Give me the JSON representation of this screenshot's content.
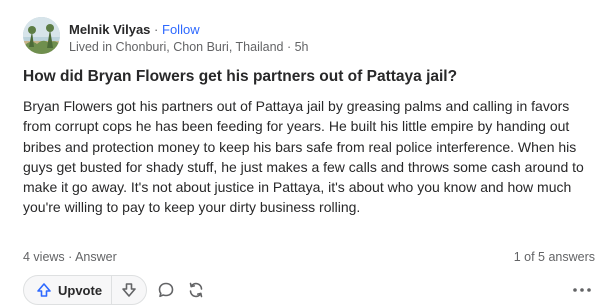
{
  "author": {
    "name": "Melnik Vilyas",
    "separator": "·",
    "follow_label": "Follow",
    "credential": "Lived in Chonburi, Chon Buri, Thailand · 5h"
  },
  "question": {
    "title": "How did Bryan Flowers get his partners out of Pattaya jail?"
  },
  "answer": {
    "body": "Bryan Flowers got his partners out of Pattaya jail by greasing palms and calling in favors from corrupt cops he has been feeding for years. He built his little empire by handing out bribes and protection money to keep his bars safe from real police interference. When his guys get busted for shady stuff, he just makes a few calls and throws some cash around to make it go away. It's not about justice in Pattaya, it's about who you know and how much you're willing to pay to keep your dirty business rolling.",
    "meta": "4 views · Answer",
    "position": "1 of 5 answers"
  },
  "actions": {
    "upvote_label": "Upvote",
    "icons": {
      "upvote": "upvote-arrow-icon",
      "downvote": "downvote-arrow-icon",
      "comment": "comment-icon",
      "share": "share-icon",
      "more": "more-options-icon"
    }
  },
  "colors": {
    "link": "#2e69ff",
    "text": "#282829",
    "muted": "#636466",
    "border": "#dee0e1"
  }
}
